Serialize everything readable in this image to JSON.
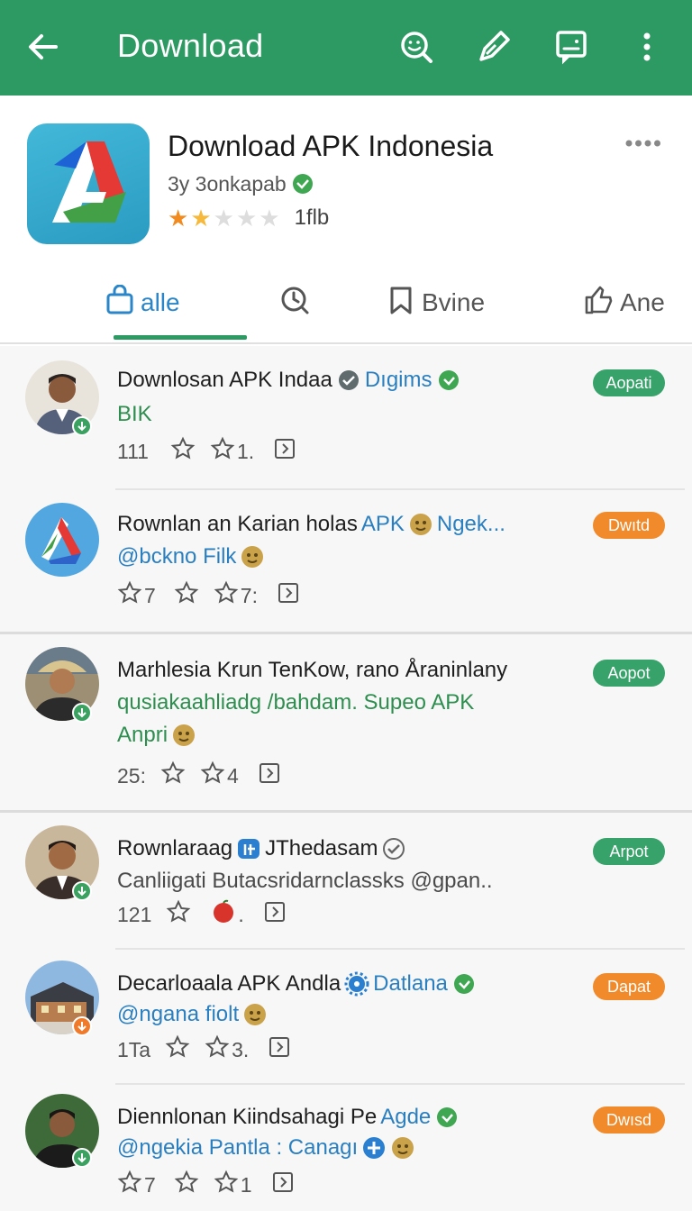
{
  "appbar": {
    "title": "Download",
    "icons": [
      "back-arrow-icon",
      "search-face-icon",
      "pen-icon",
      "chat-icon",
      "more-vert-icon"
    ]
  },
  "app": {
    "name": "Download APK Indonesia",
    "developer": "3y 3onkapab",
    "rating_stars": 1.5,
    "rating_count": "1flb"
  },
  "tabs": [
    {
      "label": "alle",
      "icon": "bag-icon"
    },
    {
      "label": "",
      "icon": "clock-search-icon"
    },
    {
      "label": "Bvine",
      "icon": "bookmark-icon"
    },
    {
      "label": "Ane",
      "icon": "thumbs-up-icon"
    }
  ],
  "colors": {
    "appbar": "#2e9a63",
    "tab_active": "#2a86c8",
    "pill_green": "#37a26a",
    "pill_orange": "#f08a2a"
  },
  "items": [
    {
      "title": "Downlosan APK Indaa",
      "title_tail": "Dıgims",
      "line2": "BIK",
      "line3": "",
      "meta_count": "111",
      "meta_2": "1.",
      "pill": "Aopati"
    },
    {
      "title": "Rownlan an Karian holas",
      "title_tail": "APK",
      "title_tail2": "Ngek...",
      "line2": "@bckno Filk",
      "line3": "",
      "meta_count": "7",
      "meta_2": "7:",
      "pill": "Dwıtd"
    },
    {
      "title": "Marhlesia Krun TenKow, rano Åraninlany",
      "line2": "qusiakaahliadg /bahdam. Supeo APK",
      "line3": "Anpri",
      "meta_count": "25:",
      "meta_2": "4",
      "pill": "Aopot"
    },
    {
      "title": "Rownlaraag",
      "title_tail": "JThedasam",
      "line2": "Canliigati Butacsridarnclassks @gpan..",
      "line3": "",
      "meta_count": "121",
      "meta_2": ".",
      "pill": "Arpot"
    },
    {
      "title": "Decarloaala APK Andla",
      "title_tail": "Datlana",
      "line2": "@ngana fiolt",
      "line3": "",
      "meta_count": "1Ta",
      "meta_2": "3.",
      "pill": "Dapat"
    },
    {
      "title": "Diennlonan Kiindsahagi Pe",
      "title_tail": "Agde",
      "line2": "@ngekia Pantla : Canagı",
      "line3": "",
      "meta_count": "7",
      "meta_2": "1",
      "pill": "Dwısd"
    }
  ]
}
